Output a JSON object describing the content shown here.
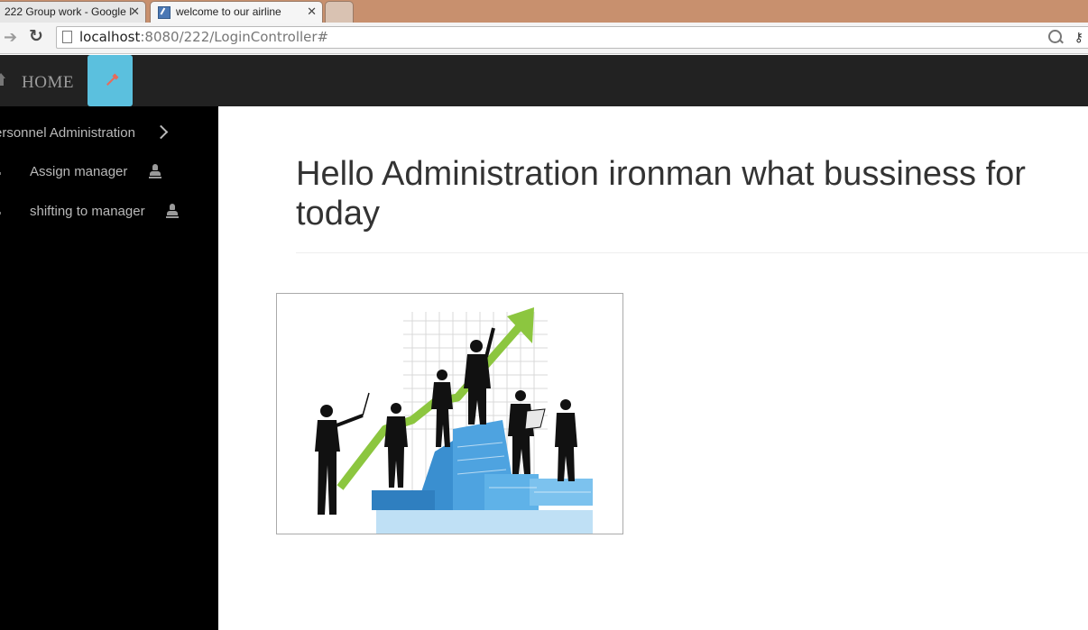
{
  "browser": {
    "tabs": [
      {
        "label": "222 Group work - Google I",
        "active": false
      },
      {
        "label": "welcome to our airline",
        "active": true
      },
      {
        "label": "",
        "active": false
      }
    ],
    "address": {
      "host": "localhost",
      "path": ":8080/222/LoginController#"
    }
  },
  "navbar": {
    "home_label": "HOME",
    "home_icon": "home-icon",
    "tool_icon": "wrench-icon",
    "colors": {
      "bg": "#222222",
      "tool_button": "#5bc0de"
    }
  },
  "sidebar": {
    "heading": "ersonnel Administration",
    "items": [
      {
        "label": "Assign manager",
        "icon": "user-icon"
      },
      {
        "label": "shifting to manager",
        "icon": "user-icon"
      }
    ],
    "colors": {
      "bg": "#000000",
      "text": "#b9b9b9"
    }
  },
  "main": {
    "title": "Hello Administration ironman what bussiness for today"
  },
  "image": {
    "colors": {
      "arrow": "#8cc63f",
      "buildings": "#3a8fd0",
      "figures": "#111111"
    }
  }
}
